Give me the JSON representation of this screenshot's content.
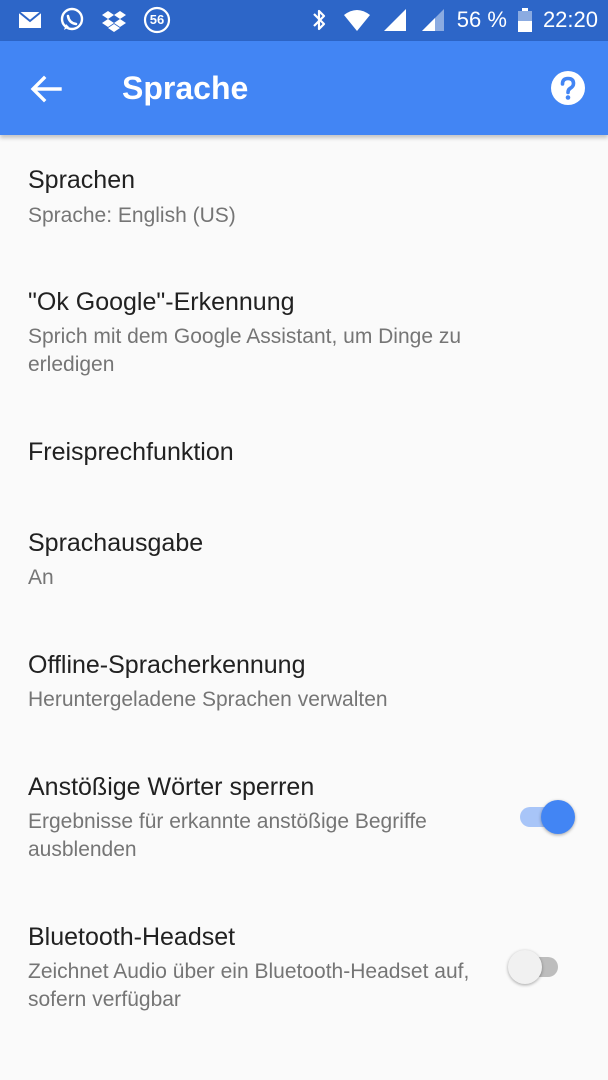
{
  "status_bar": {
    "left_icons": [
      "mail-icon",
      "whatsapp-icon",
      "dropbox-icon",
      "notification-56-icon"
    ],
    "notification_badge": "56",
    "right_icons": [
      "bluetooth-icon",
      "wifi-icon",
      "signal-icon",
      "signal-icon-2",
      "battery-icon"
    ],
    "battery": "56 %",
    "time": "22:20"
  },
  "app_bar": {
    "title": "Sprache",
    "background_color": "#4285f4",
    "status_color": "#2d66c8"
  },
  "settings": [
    {
      "title": "Sprachen",
      "subtitle": "Sprache: English (US)"
    },
    {
      "title": "\"Ok Google\"-Erkennung",
      "subtitle": "Sprich mit dem Google Assistant, um Dinge zu erledigen"
    },
    {
      "title": "Freisprechfunktion"
    },
    {
      "title": "Sprachausgabe",
      "subtitle": "An"
    },
    {
      "title": "Offline-Spracherkennung",
      "subtitle": "Heruntergeladene Sprachen verwalten"
    },
    {
      "title": "Anstößige Wörter sperren",
      "subtitle": "Ergebnisse für erkannte anstößige Begriffe ausblenden",
      "toggle": "on"
    },
    {
      "title": "Bluetooth-Headset",
      "subtitle": "Zeichnet Audio über ein Bluetooth-Headset auf, sofern verfügbar",
      "toggle": "off"
    }
  ]
}
